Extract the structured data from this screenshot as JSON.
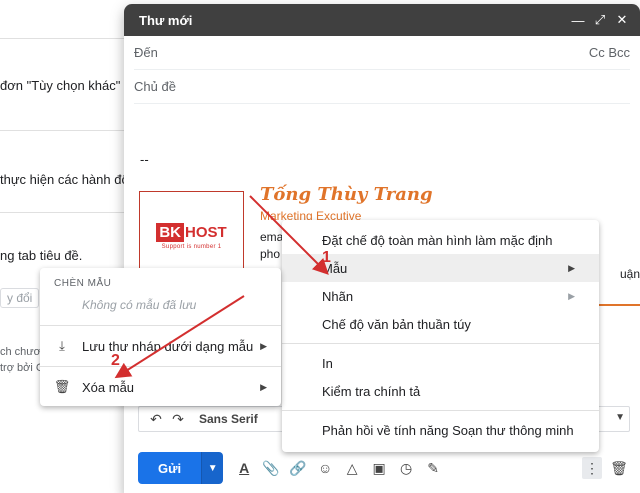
{
  "background": {
    "lines": [
      "đơn \"Tùy chọn khác\" tr",
      "thực hiện các hành độ",
      "ng tab tiêu đề.",
      "y đổi",
      "ch chươn",
      "trợ bởi G"
    ]
  },
  "compose": {
    "title": "Thư mới",
    "to_label": "Đến",
    "cc_bcc": "Cc Bcc",
    "subject_label": "Chủ đề",
    "signature": {
      "dash": "--",
      "logo_bk": "BK",
      "logo_host": "HOST",
      "logo_tagline": "Support is number 1",
      "name": "Tống Thùy Trang",
      "role": "Marketing Excutive",
      "email_prefix": "ema",
      "phone_prefix": "pho",
      "tail_text": "uận,"
    },
    "toolbar": {
      "font": "Sans Serif"
    },
    "send_label": "Gửi"
  },
  "main_menu": {
    "items": [
      {
        "label": "Đặt chế độ toàn màn hình làm mặc định"
      },
      {
        "label": "Mẫu",
        "submenu": true,
        "highlighted": true
      },
      {
        "label": "Nhãn",
        "submenu": true
      },
      {
        "label": "Chế độ văn bản thuần túy"
      },
      {
        "label": "In"
      },
      {
        "label": "Kiểm tra chính tả"
      },
      {
        "label": "Phản hồi về tính năng Soạn thư thông minh"
      }
    ]
  },
  "sub_menu": {
    "heading": "CHÈN MẪU",
    "empty_text": "Không có mẫu đã lưu",
    "save_label": "Lưu thư nháp dưới dạng mẫu",
    "delete_label": "Xóa mẫu"
  },
  "annotations": {
    "step1": "1",
    "step2": "2",
    "color": "#d32f2f"
  }
}
